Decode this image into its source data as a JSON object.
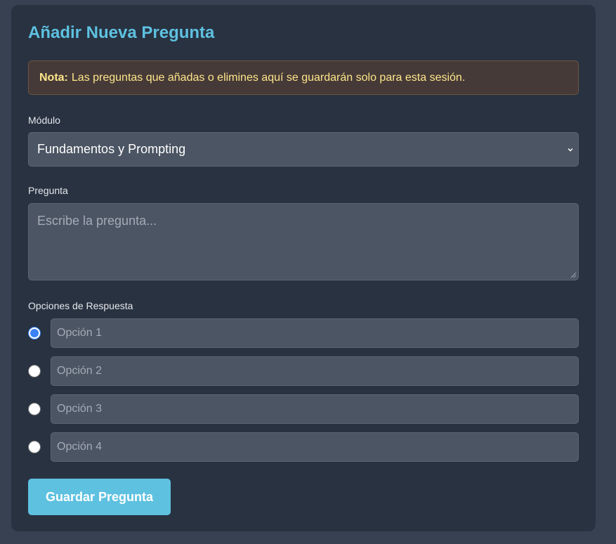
{
  "title": "Añadir Nueva Pregunta",
  "note": {
    "label": "Nota:",
    "text": "Las preguntas que añadas o elimines aquí se guardarán solo para esta sesión."
  },
  "module": {
    "label": "Módulo",
    "selected": "Fundamentos y Prompting"
  },
  "question": {
    "label": "Pregunta",
    "placeholder": "Escribe la pregunta..."
  },
  "options": {
    "label": "Opciones de Respuesta",
    "items": [
      {
        "placeholder": "Opción 1",
        "checked": true
      },
      {
        "placeholder": "Opción 2",
        "checked": false
      },
      {
        "placeholder": "Opción 3",
        "checked": false
      },
      {
        "placeholder": "Opción 4",
        "checked": false
      }
    ]
  },
  "save_button": "Guardar Pregunta",
  "colors": {
    "accent": "#5ec1e0",
    "radio_checked": "#3b82f6",
    "note_text": "#fde68a"
  }
}
